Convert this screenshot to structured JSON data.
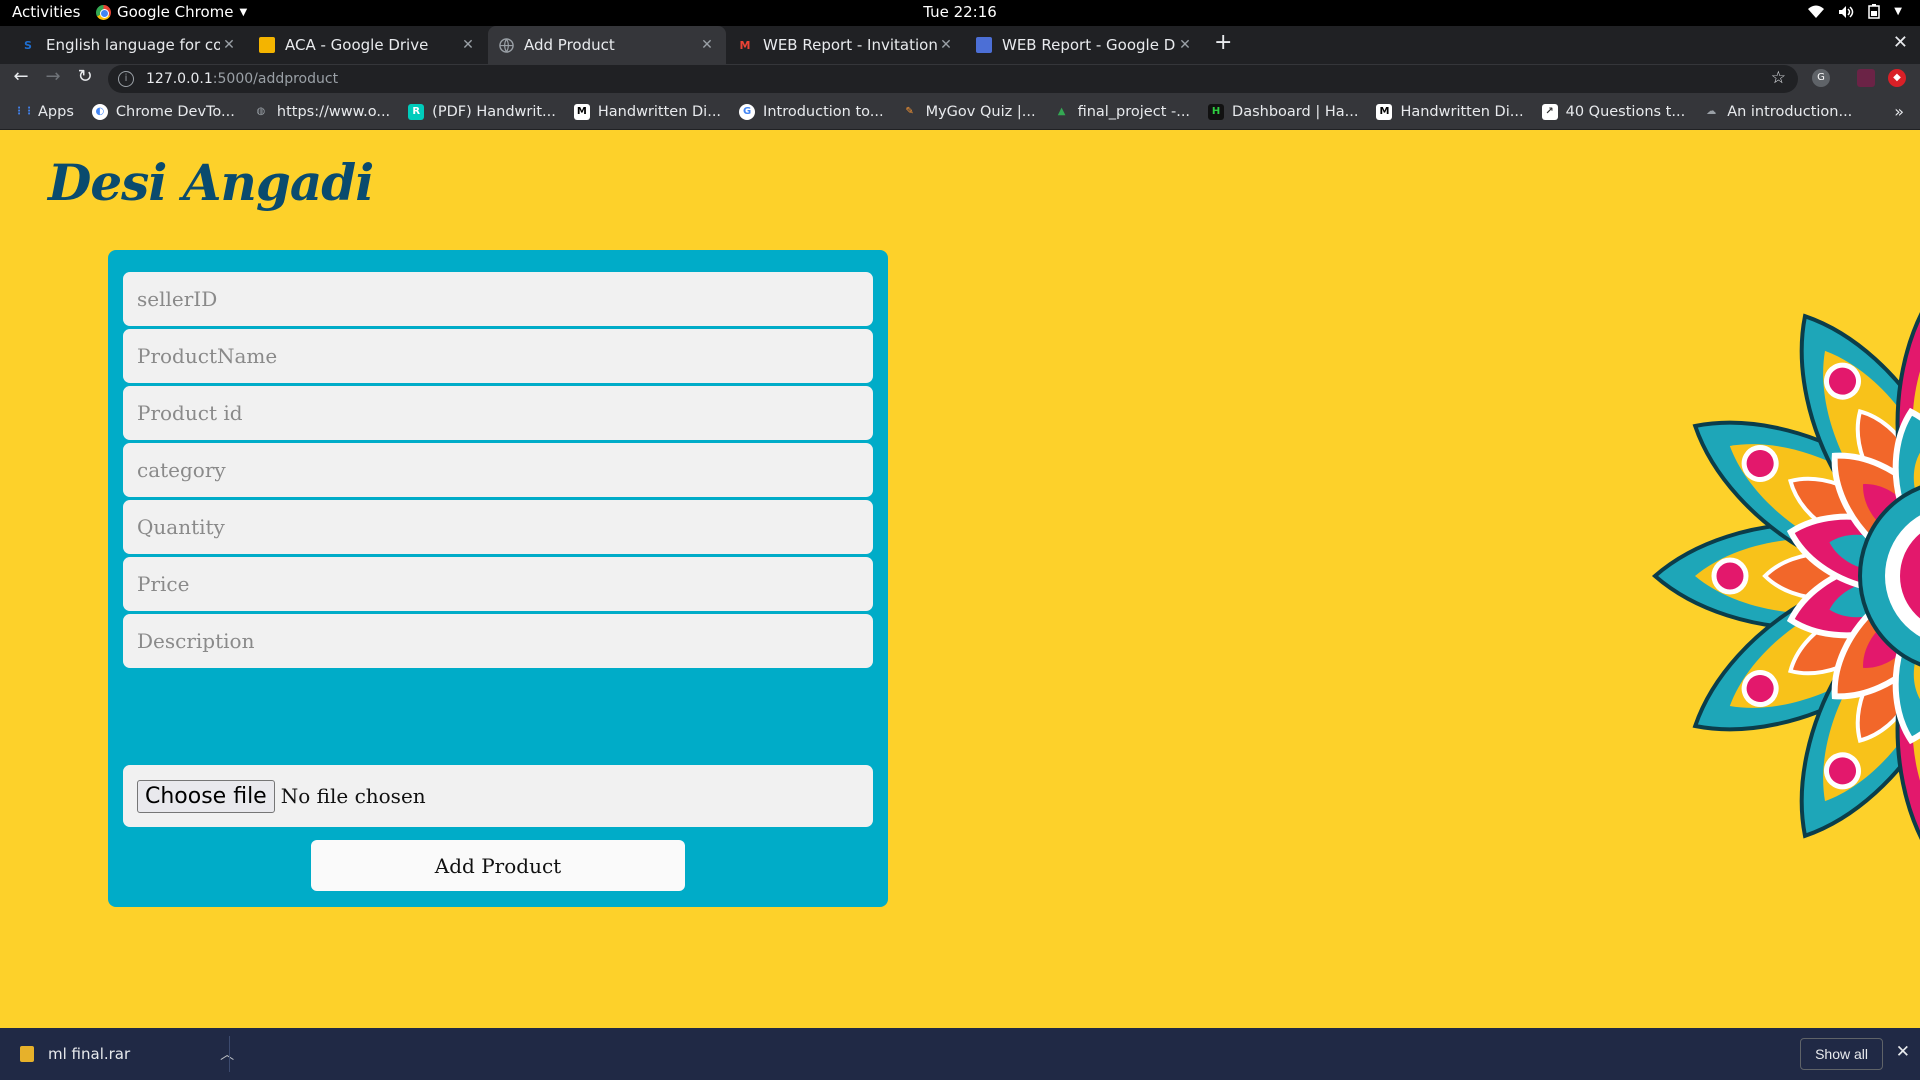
{
  "system_bar": {
    "activities": "Activities",
    "app_name": "Google Chrome",
    "clock": "Tue 22:16"
  },
  "tabs": [
    {
      "label": "English language for comp",
      "favicon": "S",
      "favicon_color": "#1f6fd1",
      "active": false
    },
    {
      "label": "ACA - Google Drive",
      "favicon": "",
      "favicon_color": "#f4b400",
      "active": false
    },
    {
      "label": "Add Product",
      "favicon": "",
      "favicon_color": "#9aa0a6",
      "active": true
    },
    {
      "label": "WEB Report - Invitation to",
      "favicon": "M",
      "favicon_color": "#ea4335",
      "active": false
    },
    {
      "label": "WEB Report - Google Doc",
      "favicon": "",
      "favicon_color": "#4c6fd6",
      "active": false
    }
  ],
  "address_bar": {
    "host": "127.0.0.1",
    "path": ":5000/addproduct"
  },
  "bookmarks": [
    {
      "label": "Apps",
      "icon": "apps-grid-icon",
      "color": "#4285f4"
    },
    {
      "label": "Chrome DevTo...",
      "icon": "devtools-icon",
      "color": "#ffffff"
    },
    {
      "label": "https://www.o...",
      "icon": "globe-icon",
      "color": "#9aa0a6"
    },
    {
      "label": "(PDF) Handwrit...",
      "icon": "researchgate-icon",
      "color": "#00ccbb"
    },
    {
      "label": "Handwritten Di...",
      "icon": "medium-icon",
      "color": "#ffffff"
    },
    {
      "label": "Introduction to...",
      "icon": "google-icon",
      "color": "#ffffff"
    },
    {
      "label": "MyGov Quiz |...",
      "icon": "mygov-icon",
      "color": "#ff9933"
    },
    {
      "label": "final_project -...",
      "icon": "drive-icon",
      "color": "#34a853"
    },
    {
      "label": "Dashboard | Ha...",
      "icon": "hackerearth-icon",
      "color": "#2d8f3c"
    },
    {
      "label": "Handwritten Di...",
      "icon": "medium-icon",
      "color": "#ffffff"
    },
    {
      "label": "40 Questions t...",
      "icon": "analytics-icon",
      "color": "#ffffff"
    },
    {
      "label": "An introduction...",
      "icon": "kaggle-icon",
      "color": "#9aa0a6"
    }
  ],
  "page": {
    "logo_text": "Desi Angadi",
    "background_color": "#fdd12a",
    "card_color": "#00acc8",
    "fields": [
      {
        "name": "sellerid-input",
        "placeholder": "sellerID"
      },
      {
        "name": "productname-input",
        "placeholder": "ProductName"
      },
      {
        "name": "productid-input",
        "placeholder": "Product id"
      },
      {
        "name": "category-input",
        "placeholder": "category"
      },
      {
        "name": "quantity-input",
        "placeholder": "Quantity"
      },
      {
        "name": "price-input",
        "placeholder": "Price"
      },
      {
        "name": "description-input",
        "placeholder": "Description"
      }
    ],
    "file_button": "Choose file",
    "file_status": "No file chosen",
    "submit_label": "Add Product"
  },
  "download_shelf": {
    "file_name": "ml final.rar",
    "show_all": "Show all"
  }
}
